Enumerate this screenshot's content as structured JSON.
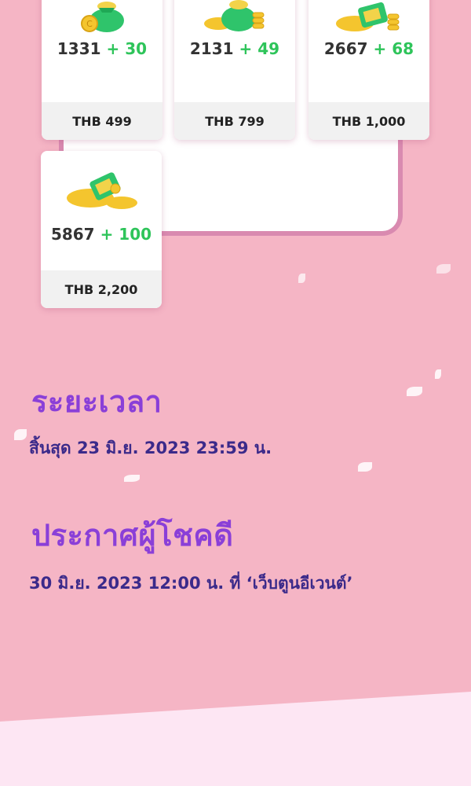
{
  "packages": [
    {
      "amount": "1331",
      "bonus": "+ 30",
      "price": "THB 499",
      "icon": "coin-bag-small-icon"
    },
    {
      "amount": "2131",
      "bonus": "+ 49",
      "price": "THB 799",
      "icon": "coin-bag-medium-icon"
    },
    {
      "amount": "2667",
      "bonus": "+ 68",
      "price": "THB 1,000",
      "icon": "coin-chest-icon"
    },
    {
      "amount": "5867",
      "bonus": "+ 100",
      "price": "THB 2,200",
      "icon": "coin-pile-icon"
    }
  ],
  "period": {
    "heading": "ระยะเวลา",
    "detail": "สิ้นสุด 23 มิ.ย. 2023 23:59 น."
  },
  "announcement": {
    "heading": "ประกาศผู้โชคดี",
    "detail": "30 มิ.ย. 2023 12:00 น. ที่ ‘เว็บตูนอีเวนต์’"
  },
  "colors": {
    "background": "#f5b5c5",
    "heading": "#8a3fd8",
    "detail": "#3b2a8a",
    "bonus": "#2ec45a"
  }
}
